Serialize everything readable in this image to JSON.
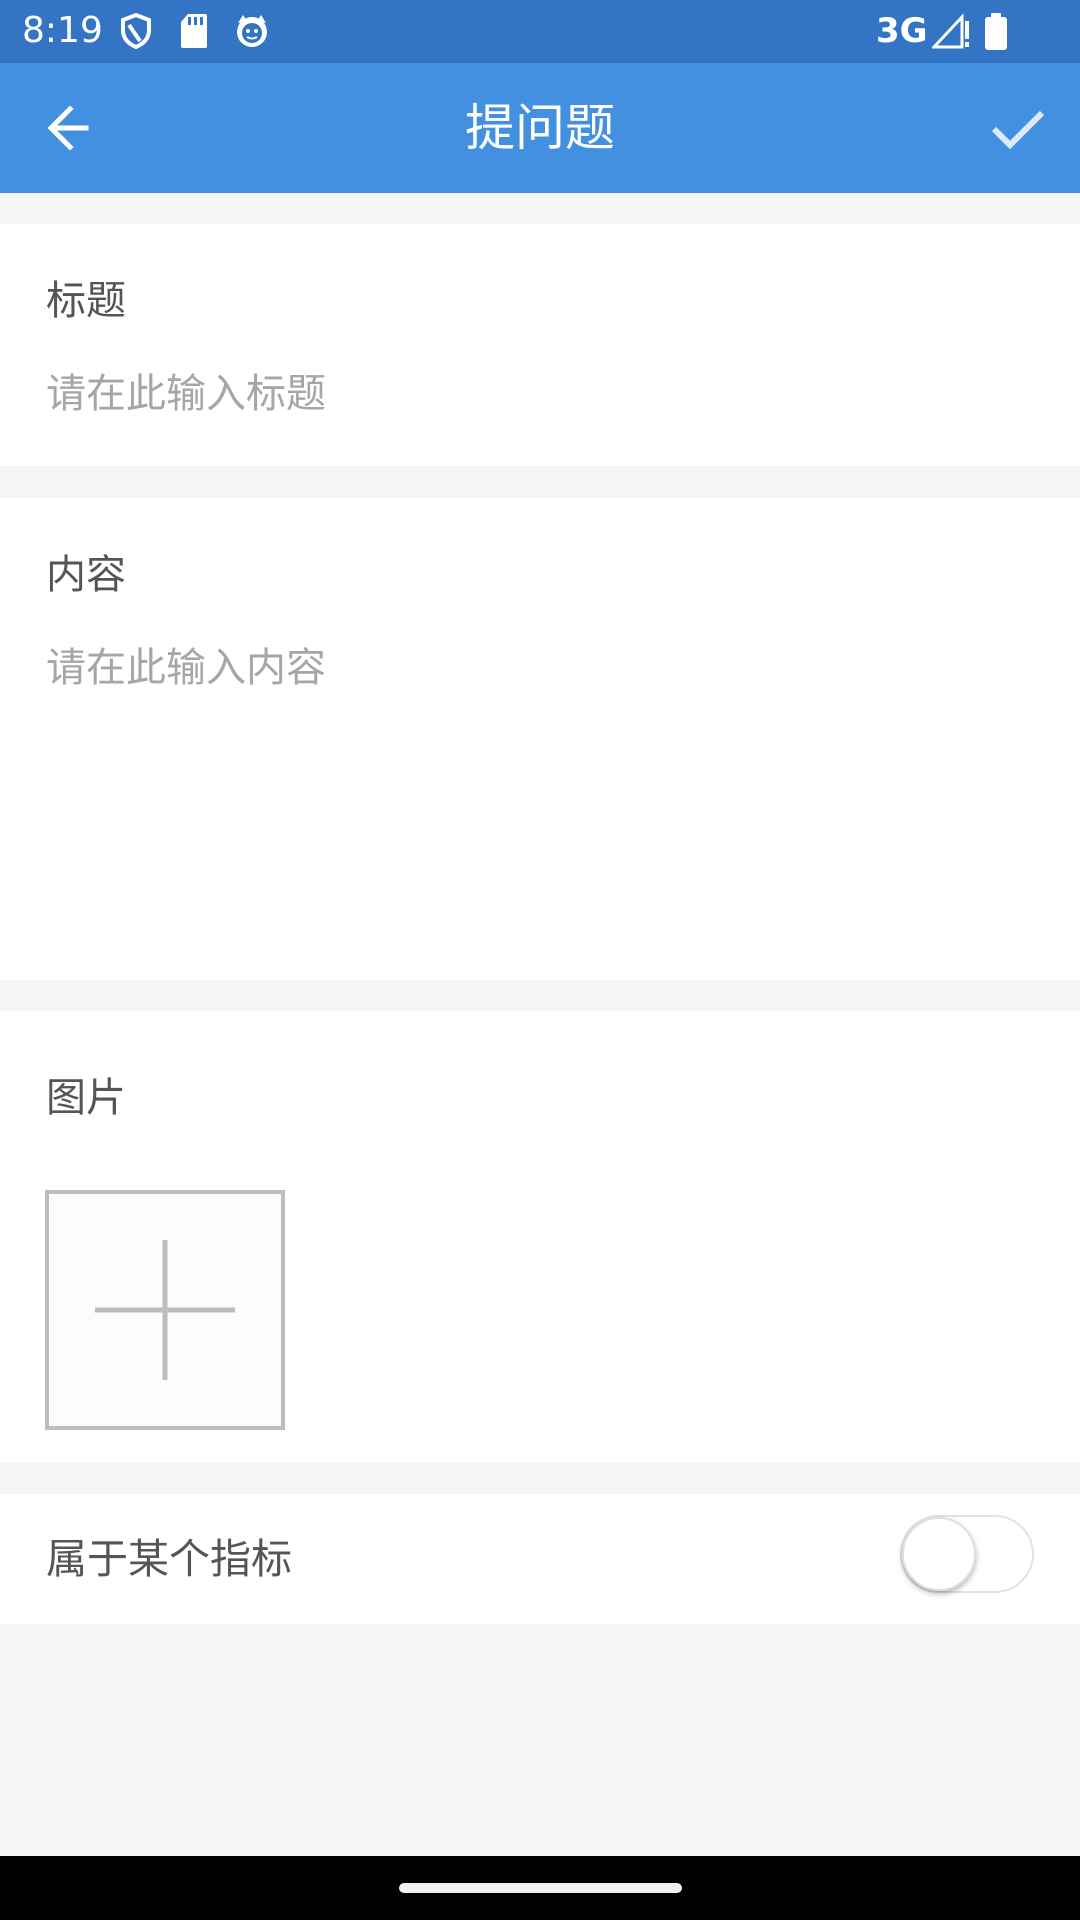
{
  "status_bar": {
    "time": "8:19",
    "network": "3G",
    "icons": [
      "shield-icon",
      "sd-card-icon",
      "cat-face-icon",
      "signal-icon",
      "battery-icon"
    ],
    "background": "#3374c4"
  },
  "app_bar": {
    "title": "提问题",
    "back_icon": "arrow-left-icon",
    "confirm_icon": "check-icon",
    "background": "#4290df"
  },
  "title_section": {
    "label": "标题",
    "placeholder": "请在此输入标题",
    "value": ""
  },
  "content_section": {
    "label": "内容",
    "placeholder": "请在此输入内容",
    "value": ""
  },
  "image_section": {
    "label": "图片",
    "add_icon": "plus-icon"
  },
  "indicator_section": {
    "label": "属于某个指标",
    "toggle_on": false
  }
}
